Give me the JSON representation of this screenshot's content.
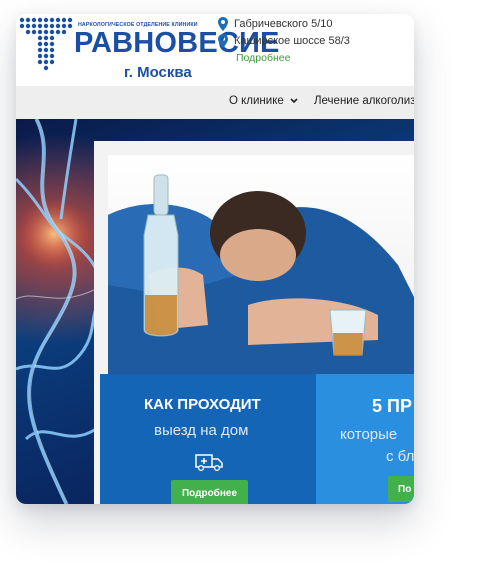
{
  "header": {
    "clinic_subtitle": "НАРКОЛОГИЧЕСКОЕ ОТДЕЛЕНИЕ КЛИНИКИ",
    "brand": "РАВНОВЕСИЕ",
    "city": "г. Москва",
    "addresses": [
      "Габричевского 5/10",
      "Каширское шоссе 58/3"
    ],
    "more_link": "Подробнее",
    "brand_color": "#1b4fa5",
    "link_color": "#3a9a3a"
  },
  "nav": {
    "items": [
      "О клинике",
      "Лечение алкоголизма"
    ]
  },
  "promos": [
    {
      "title": "КАК ПРОХОДИТ",
      "subtitle": "выезд на дом",
      "button": "Подробнее",
      "icon": "ambulance-icon"
    },
    {
      "title": "5 ПР",
      "subtitle": "которые",
      "subtitle2": "с бл",
      "button": "По"
    }
  ],
  "colors": {
    "promo1": "#1565b6",
    "promo2": "#2b8fe0",
    "button": "#43b14b"
  }
}
